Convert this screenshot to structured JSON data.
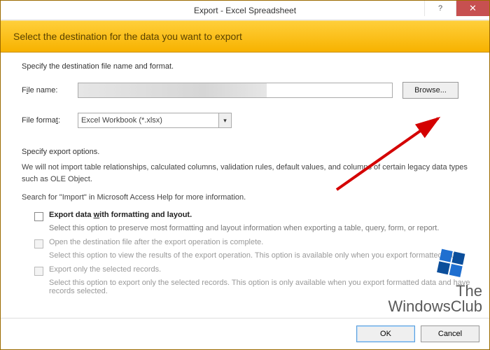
{
  "titlebar": {
    "title": "Export - Excel Spreadsheet",
    "help_icon": "?",
    "close_icon": "✕"
  },
  "banner": {
    "heading": "Select the destination for the data you want to export"
  },
  "dest": {
    "section_label": "Specify the destination file name and format.",
    "file_label_pre": "F",
    "file_label_u": "i",
    "file_label_post": "le name:",
    "file_value": "",
    "browse_label": "Browse...",
    "format_label_pre": "File forma",
    "format_label_u": "t",
    "format_label_post": ":",
    "format_value": "Excel Workbook (*.xlsx)"
  },
  "options": {
    "section_label": "Specify export options.",
    "warn": "We will not import table relationships, calculated columns, validation rules, default values, and columns of certain legacy data types such as OLE Object.",
    "help_hint": "Search for \"Import\" in Microsoft Access Help for more information.",
    "opt1_label_pre": "Export data ",
    "opt1_label_u": "w",
    "opt1_label_post": "ith formatting and layout.",
    "opt1_sub": "Select this option to preserve most formatting and layout information when exporting a table, query, form, or report.",
    "opt2_label": "Open the destination file after the export operation is complete.",
    "opt2_sub": "Select this option to view the results of the export operation. This option is available only when you export formatted data.",
    "opt3_label": "Export only the selected records.",
    "opt3_sub": "Select this option to export only the selected records. This option is only available when you export formatted data and have records selected."
  },
  "footer": {
    "ok": "OK",
    "cancel": "Cancel"
  },
  "watermark": {
    "line1": "The",
    "line2": "WindowsClub"
  }
}
